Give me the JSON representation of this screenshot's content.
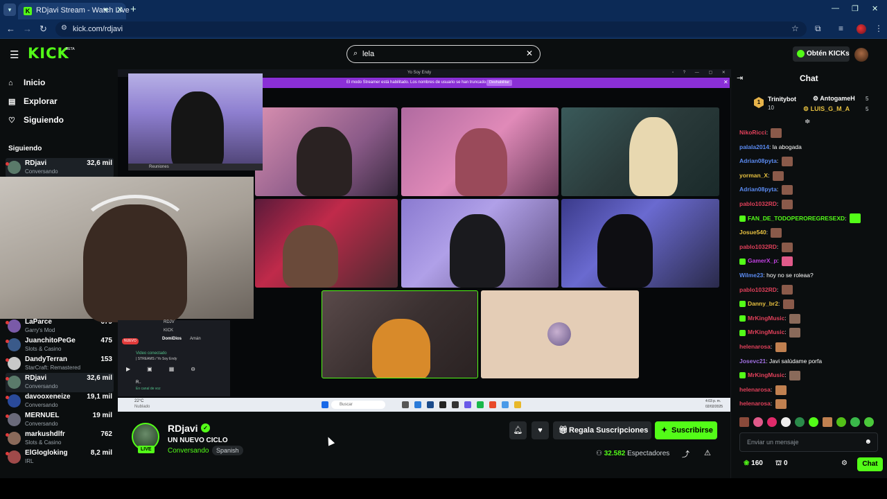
{
  "browser": {
    "tab_title": "RDjavi Stream - Watch Live",
    "url": "kick.com/rdjavi",
    "tab_favicon": "K",
    "icons": [
      "menu-icon",
      "audio-icon",
      "close-icon",
      "plus-icon",
      "back-icon",
      "forward-icon",
      "reload-icon",
      "site-info-icon",
      "star-icon",
      "extensions-icon",
      "media-icon",
      "profile-icon",
      "more-icon"
    ]
  },
  "header": {
    "logo": "KICK",
    "beta": "BETA",
    "search_value": "lela",
    "kicks_button": "Obtén KICKs"
  },
  "sidebar": {
    "nav": [
      {
        "label": "Inicio",
        "icon": "⌂"
      },
      {
        "label": "Explorar",
        "icon": "▤"
      },
      {
        "label": "Siguiendo",
        "icon": "♡"
      }
    ],
    "following_header": "Siguiendo",
    "following": [
      {
        "name": "RDjavi",
        "category": "Conversando",
        "viewers": "32,6 mil",
        "avatar": "#5a7a6a"
      },
      {
        "name": "LaParce",
        "category": "Garry's Mod",
        "viewers": "679",
        "avatar": "#7a5aa8"
      },
      {
        "name": "JuanchitoPeGe",
        "category": "Slots & Casino",
        "viewers": "475",
        "avatar": "#3a5a8a"
      },
      {
        "name": "DandyTerran",
        "category": "StarCraft: Remastered",
        "viewers": "153",
        "avatar": "#c8c8c8"
      },
      {
        "name": "RDjavi",
        "category": "Conversando",
        "viewers": "32,6 mil",
        "avatar": "#5a7a6a"
      },
      {
        "name": "davooxeneize",
        "category": "Conversando",
        "viewers": "19,1 mil",
        "avatar": "#2a4a9a"
      },
      {
        "name": "MERNUEL",
        "category": "Conversando",
        "viewers": "19 mil",
        "avatar": "#6a6a7a"
      },
      {
        "name": "markushdlfr",
        "category": "Slots & Casino",
        "viewers": "762",
        "avatar": "#8a6a5a"
      },
      {
        "name": "ElGlogloking",
        "category": "IRL",
        "viewers": "8,2 mil",
        "avatar": "#a04a4a"
      }
    ]
  },
  "stream_overlay": {
    "window_title": "Yo Soy Endy",
    "banner_text": "El modo Streamer está habilitado. Los nombres de usuario se han truncado.",
    "banner_button": "Deshabilitar",
    "mini_panel": {
      "title": "Reuniones",
      "user1": "RDJV",
      "user2": "KICK",
      "user3": "DomiDios",
      "user4": "Amán",
      "video_status": "Video conectado",
      "video_sub": "| STREAMS / Yo Soy Endy",
      "footer_user": "R..",
      "footer_status": "En canal de voz",
      "badge": "NUEVO"
    },
    "taskbar_search": "Buscar",
    "weather_temp": "22°C",
    "weather_label": "Nublado",
    "clock_time": "4:03 p. m.",
    "clock_date": "02/02/2025"
  },
  "stream_info": {
    "channel": "RDjavi",
    "title": "UN NUEVO CICLO",
    "category": "Conversando",
    "language": "Spanish",
    "live": "LIVE",
    "gift_button": "Regala Suscripciones",
    "subscribe_button": "Suscribirse",
    "viewers_count": "32.582",
    "viewers_label": "Espectadores"
  },
  "chat": {
    "title": "Chat",
    "leaderboard": {
      "top_name": "Trinitybot",
      "top_value": "10",
      "top_rank": "1",
      "entries": [
        {
          "name": "AntogameH",
          "value": "5"
        },
        {
          "name": "LUIS_G_M_A",
          "value": "5"
        }
      ]
    },
    "messages": [
      {
        "user": "NikoRicci",
        "color": "#e0405a",
        "text": "",
        "emote": "#8a5a4a"
      },
      {
        "user": "palala2014",
        "color": "#5a8af0",
        "text": "la abogada",
        "emote": ""
      },
      {
        "user": "Adrian08pyta",
        "color": "#5a8af0",
        "text": "",
        "emote": "#8a5a4a"
      },
      {
        "user": "yorman_X",
        "color": "#e6c040",
        "text": "",
        "emote": "#8a5a4a"
      },
      {
        "user": "Adrian08pyta",
        "color": "#5a8af0",
        "text": "",
        "emote": "#8a5a4a"
      },
      {
        "user": "pablo1032RD",
        "color": "#e0405a",
        "text": "",
        "emote": "#8a5a4a"
      },
      {
        "user": "FAN_DE_TODOPEROREGRESEXD",
        "color": "#53fc18",
        "text": "",
        "emote": "#53fc18",
        "badge": "#53fc18"
      },
      {
        "user": "Josue540",
        "color": "#e6c040",
        "text": "",
        "emote": "#8a5a4a"
      },
      {
        "user": "pablo1032RD",
        "color": "#e0405a",
        "text": "",
        "emote": "#8a5a4a"
      },
      {
        "user": "GamerX_p",
        "color": "#c040e0",
        "text": "",
        "emote": "#e05a8a",
        "badge": "#53fc18"
      },
      {
        "user": "Wilme23",
        "color": "#5a8af0",
        "text": "hoy no se roleaa?",
        "emote": ""
      },
      {
        "user": "pablo1032RD",
        "color": "#e0405a",
        "text": "",
        "emote": "#8a5a4a"
      },
      {
        "user": "Danny_br2",
        "color": "#e6c040",
        "text": "",
        "emote": "#8a5a4a",
        "badge": "#53fc18"
      },
      {
        "user": "MrKingMusic",
        "color": "#e0405a",
        "text": "",
        "emote": "#8a6a5a",
        "badge": "#53fc18"
      },
      {
        "user": "MrKingMusic",
        "color": "#e0405a",
        "text": "",
        "emote": "#8a6a5a",
        "badge": "#53fc18"
      },
      {
        "user": "helenarosa",
        "color": "#e0405a",
        "text": "",
        "emote": "#c08050"
      },
      {
        "user": "Josevc21",
        "color": "#a070e0",
        "text": "Javi salúdame porfa",
        "emote": ""
      },
      {
        "user": "MrKingMusic",
        "color": "#e0405a",
        "text": "",
        "emote": "#8a6a5a",
        "badge": "#53fc18"
      },
      {
        "user": "helenarosa",
        "color": "#e0405a",
        "text": "",
        "emote": "#c08050"
      },
      {
        "user": "helenarosa",
        "color": "#e0405a",
        "text": "",
        "emote": "#c08050"
      }
    ],
    "input_placeholder": "Enviar un mensaje",
    "points": "160",
    "gifts": "0",
    "send_button": "Chat"
  }
}
